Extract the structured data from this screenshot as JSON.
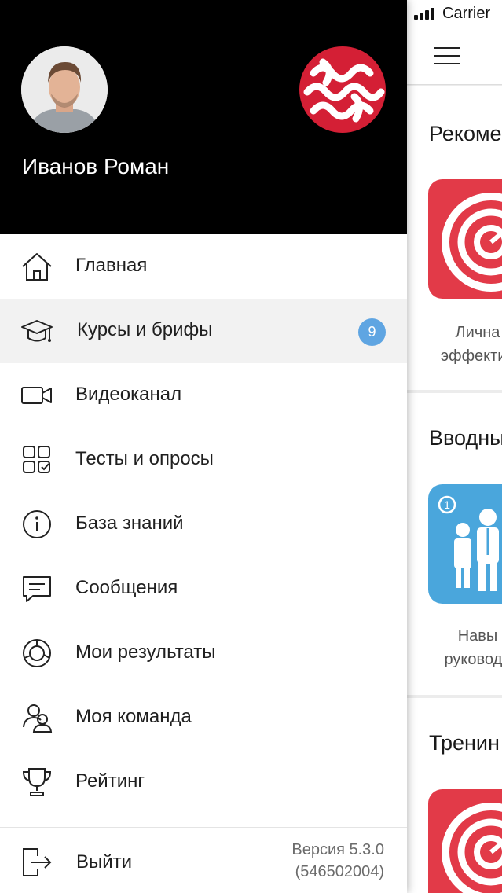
{
  "status_bar": {
    "carrier": "Carrier"
  },
  "background": {
    "sections": [
      {
        "title": "Рекоме",
        "card_text_line1": "Лична",
        "card_text_line2": "эффектив"
      },
      {
        "title": "Вводны",
        "card_text_line1": "Навы",
        "card_text_line2": "руководи"
      },
      {
        "title": "Тренин",
        "card_text_line1": "",
        "card_text_line2": ""
      }
    ]
  },
  "drawer": {
    "user_name": "Иванов Роман",
    "menu": [
      {
        "label": "Главная",
        "icon": "home-icon"
      },
      {
        "label": "Курсы и брифы",
        "icon": "graduation-cap-icon",
        "badge": "9",
        "active": true
      },
      {
        "label": "Видеоканал",
        "icon": "video-camera-icon"
      },
      {
        "label": "Тесты и опросы",
        "icon": "tests-grid-icon"
      },
      {
        "label": "База знаний",
        "icon": "info-icon"
      },
      {
        "label": "Сообщения",
        "icon": "message-icon"
      },
      {
        "label": "Мои результаты",
        "icon": "results-chart-icon"
      },
      {
        "label": "Моя команда",
        "icon": "team-icon"
      },
      {
        "label": "Рейтинг",
        "icon": "trophy-icon"
      }
    ],
    "footer": {
      "logout_label": "Выйти",
      "version_line1": "Версия 5.3.0",
      "version_line2": "(546502004)"
    }
  },
  "colors": {
    "header_bg": "#000000",
    "badge": "#5fa5e2",
    "brand_red": "#d41f35",
    "card_red": "#e23a48",
    "card_blue": "#4aa6dc",
    "active_row": "#f2f2f2"
  }
}
